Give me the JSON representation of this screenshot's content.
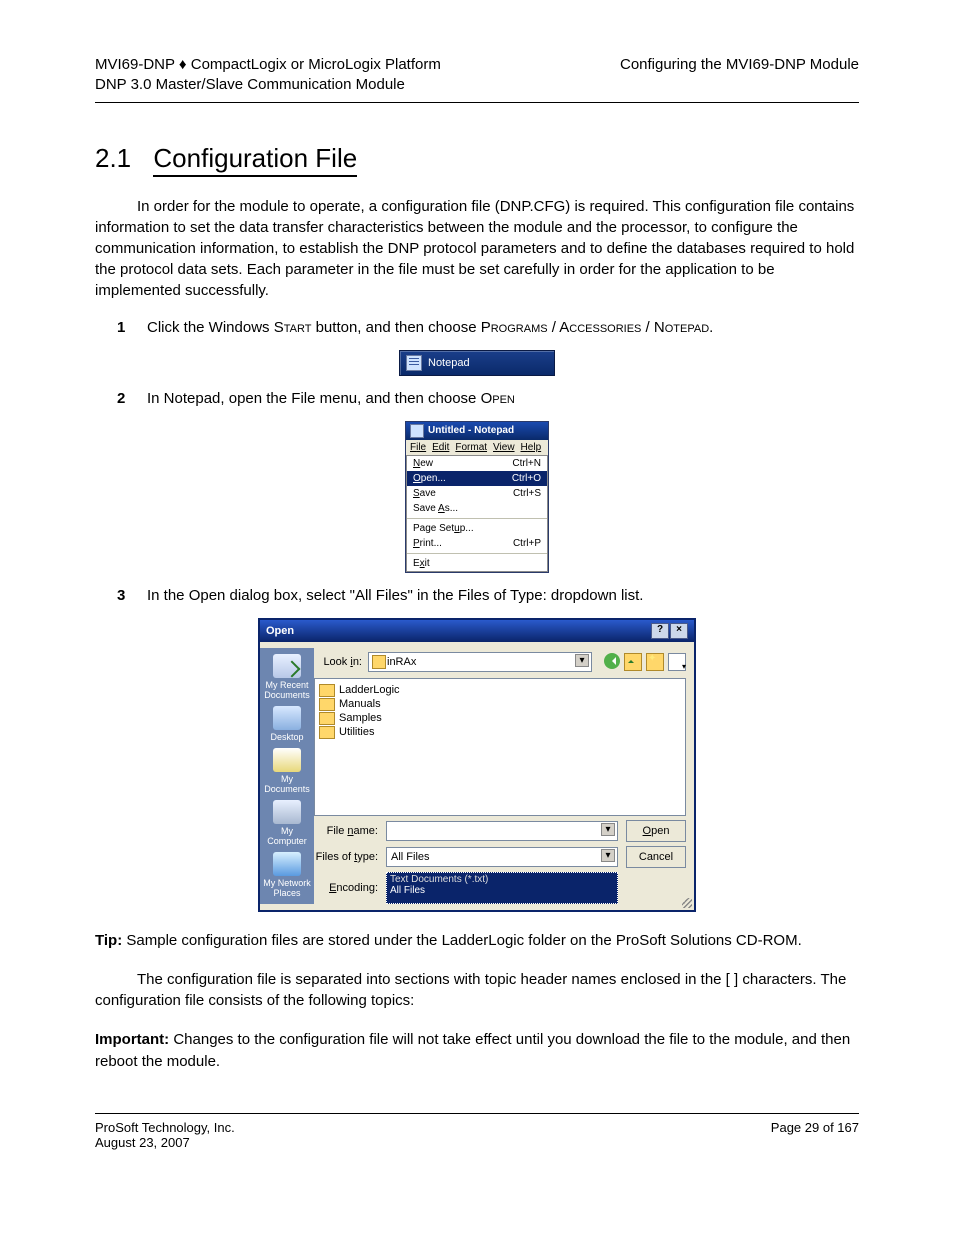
{
  "header": {
    "left1": "MVI69-DNP ♦ CompactLogix or MicroLogix Platform",
    "left2": "DNP 3.0 Master/Slave Communication Module",
    "right": "Configuring the MVI69-DNP Module"
  },
  "section": {
    "num": "2.1",
    "title": "Configuration File"
  },
  "intro": "In order for the module to operate, a configuration file (DNP.CFG) is required. This configuration file contains information to set the data transfer characteristics between the module and the processor, to configure the communication information, to establish the DNP protocol parameters and to define the databases required to hold the protocol data sets. Each parameter in the file must be set carefully in order for the application to be implemented successfully.",
  "steps": {
    "s1_a": "Click the Windows ",
    "s1_b": "Start",
    "s1_c": " button, and then choose ",
    "s1_d": "Programs / Accessories / Notepad.",
    "s2_a": "In Notepad, open the File menu, and then choose ",
    "s2_b": "Open",
    "s3_a": "In the Open dialog box, select \"All Files\" in the Files of Type: dropdown list."
  },
  "taskbar": {
    "label": "Notepad"
  },
  "npwin": {
    "title": "Untitled - Notepad",
    "menu": [
      "File",
      "Edit",
      "Format",
      "View",
      "Help"
    ],
    "items": [
      {
        "label": "New",
        "sc": "Ctrl+N"
      },
      {
        "label": "Open...",
        "sc": "Ctrl+O",
        "hl": true
      },
      {
        "label": "Save",
        "sc": "Ctrl+S"
      },
      {
        "label": "Save As...",
        "sc": ""
      }
    ],
    "items2": [
      {
        "label": "Page Setup...",
        "sc": ""
      },
      {
        "label": "Print...",
        "sc": "Ctrl+P"
      }
    ],
    "items3": [
      {
        "label": "Exit",
        "sc": ""
      }
    ]
  },
  "dlg": {
    "title": "Open",
    "lookin_label": "Look in:",
    "lookin_value": "inRAx",
    "places": [
      "My Recent Documents",
      "Desktop",
      "My Documents",
      "My Computer",
      "My Network Places"
    ],
    "folders": [
      "LadderLogic",
      "Manuals",
      "Samples",
      "Utilities"
    ],
    "file_name_label": "File name:",
    "file_name_value": "",
    "type_label": "Files of type:",
    "type_value": "All Files",
    "enc_label": "Encoding:",
    "enc_opt_top": "Text Documents (*.txt)",
    "enc_opt_hl": "All Files",
    "btn_open": "Open",
    "btn_cancel": "Cancel"
  },
  "tip": {
    "label": "Tip:",
    "text": " Sample configuration files are stored under the LadderLogic folder on the ProSoft Solutions CD-ROM."
  },
  "para2": "The configuration file is separated into sections with topic header names enclosed in the [ ] characters. The configuration file consists of the following topics:",
  "important": {
    "label": "Important:",
    "text": " Changes to the configuration file will not take effect until you download the file to the module, and then reboot the module."
  },
  "footer": {
    "left": "ProSoft Technology, Inc.",
    "right": "Page 29 of 167",
    "date": "August 23, 2007"
  }
}
